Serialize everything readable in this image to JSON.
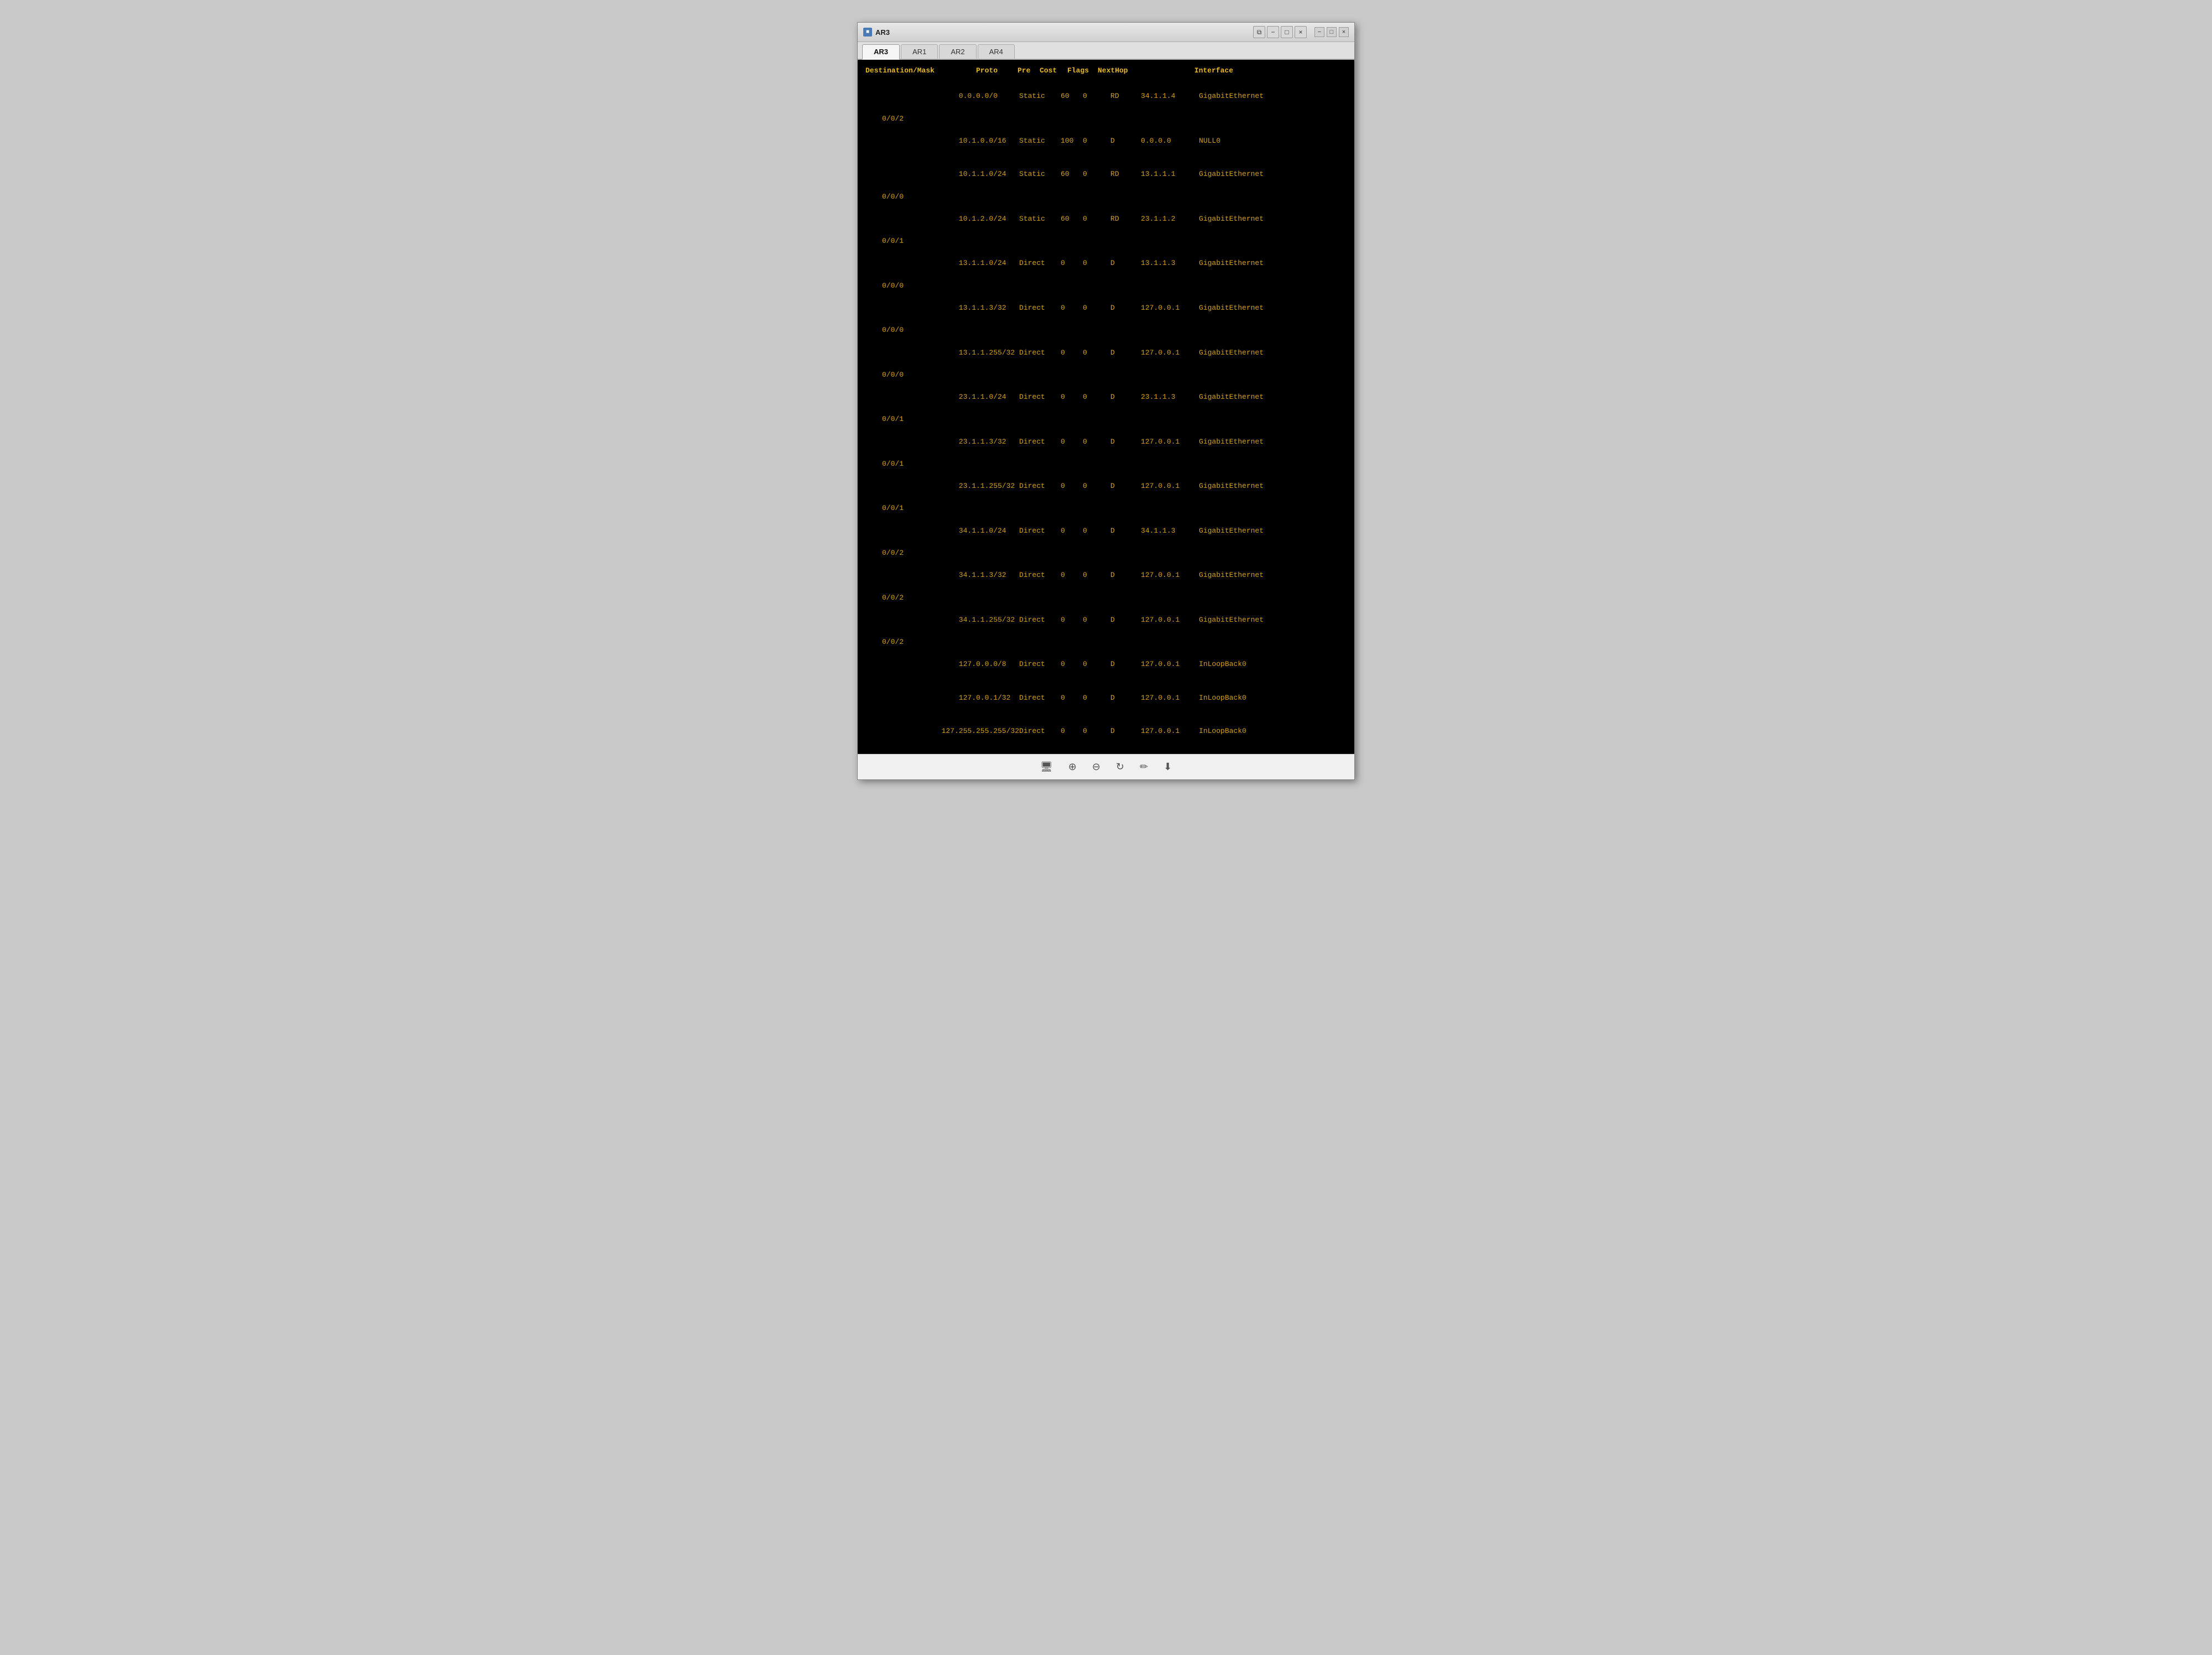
{
  "window": {
    "title": "AR3",
    "icon": "■",
    "controls": [
      "-",
      "□",
      "×"
    ],
    "inner_controls": [
      "□",
      "-",
      "□",
      "×"
    ]
  },
  "tabs": [
    {
      "label": "AR3",
      "active": true
    },
    {
      "label": "AR1",
      "active": false
    },
    {
      "label": "AR2",
      "active": false
    },
    {
      "label": "AR4",
      "active": false
    }
  ],
  "table": {
    "headers": [
      "Destination/Mask",
      "Proto",
      "Pre",
      "Cost",
      "Flags",
      "NextHop",
      "Interface"
    ],
    "routes": [
      {
        "dest": "0.0.0.0/0",
        "proto": "Static",
        "pre": "60",
        "cost": "0",
        "flags": "RD",
        "nexthop": "34.1.1.4",
        "iface": "GigabitEthernet",
        "sub": "0/0/2"
      },
      {
        "dest": "10.1.0.0/16",
        "proto": "Static",
        "pre": "100",
        "cost": "0",
        "flags": "D",
        "nexthop": "0.0.0.0",
        "iface": "NULL0",
        "sub": ""
      },
      {
        "dest": "10.1.1.0/24",
        "proto": "Static",
        "pre": "60",
        "cost": "0",
        "flags": "RD",
        "nexthop": "13.1.1.1",
        "iface": "GigabitEthernet",
        "sub": "0/0/0"
      },
      {
        "dest": "10.1.2.0/24",
        "proto": "Static",
        "pre": "60",
        "cost": "0",
        "flags": "RD",
        "nexthop": "23.1.1.2",
        "iface": "GigabitEthernet",
        "sub": "0/0/1"
      },
      {
        "dest": "13.1.1.0/24",
        "proto": "Direct",
        "pre": "0",
        "cost": "0",
        "flags": "D",
        "nexthop": "13.1.1.3",
        "iface": "GigabitEthernet",
        "sub": "0/0/0"
      },
      {
        "dest": "13.1.1.3/32",
        "proto": "Direct",
        "pre": "0",
        "cost": "0",
        "flags": "D",
        "nexthop": "127.0.0.1",
        "iface": "GigabitEthernet",
        "sub": "0/0/0"
      },
      {
        "dest": "13.1.1.255/32",
        "proto": "Direct",
        "pre": "0",
        "cost": "0",
        "flags": "D",
        "nexthop": "127.0.0.1",
        "iface": "GigabitEthernet",
        "sub": "0/0/0"
      },
      {
        "dest": "23.1.1.0/24",
        "proto": "Direct",
        "pre": "0",
        "cost": "0",
        "flags": "D",
        "nexthop": "23.1.1.3",
        "iface": "GigabitEthernet",
        "sub": "0/0/1"
      },
      {
        "dest": "23.1.1.3/32",
        "proto": "Direct",
        "pre": "0",
        "cost": "0",
        "flags": "D",
        "nexthop": "127.0.0.1",
        "iface": "GigabitEthernet",
        "sub": "0/0/1"
      },
      {
        "dest": "23.1.1.255/32",
        "proto": "Direct",
        "pre": "0",
        "cost": "0",
        "flags": "D",
        "nexthop": "127.0.0.1",
        "iface": "GigabitEthernet",
        "sub": "0/0/1"
      },
      {
        "dest": "34.1.1.0/24",
        "proto": "Direct",
        "pre": "0",
        "cost": "0",
        "flags": "D",
        "nexthop": "34.1.1.3",
        "iface": "GigabitEthernet",
        "sub": "0/0/2"
      },
      {
        "dest": "34.1.1.3/32",
        "proto": "Direct",
        "pre": "0",
        "cost": "0",
        "flags": "D",
        "nexthop": "127.0.0.1",
        "iface": "GigabitEthernet",
        "sub": "0/0/2"
      },
      {
        "dest": "34.1.1.255/32",
        "proto": "Direct",
        "pre": "0",
        "cost": "0",
        "flags": "D",
        "nexthop": "127.0.0.1",
        "iface": "GigabitEthernet",
        "sub": "0/0/2"
      },
      {
        "dest": "127.0.0.0/8",
        "proto": "Direct",
        "pre": "0",
        "cost": "0",
        "flags": "D",
        "nexthop": "127.0.0.1",
        "iface": "InLoopBack0",
        "sub": ""
      },
      {
        "dest": "127.0.0.1/32",
        "proto": "Direct",
        "pre": "0",
        "cost": "0",
        "flags": "D",
        "nexthop": "127.0.0.1",
        "iface": "InLoopBack0",
        "sub": ""
      },
      {
        "dest": "127.255.255.255/32",
        "proto": "Direct",
        "pre": "0",
        "cost": "0",
        "flags": "D",
        "nexthop": "127.0.0.1",
        "iface": "InLoopBack0",
        "sub": ""
      }
    ]
  },
  "toolbar": {
    "buttons": [
      "zoom-in",
      "zoom-out",
      "refresh",
      "edit",
      "download"
    ]
  }
}
